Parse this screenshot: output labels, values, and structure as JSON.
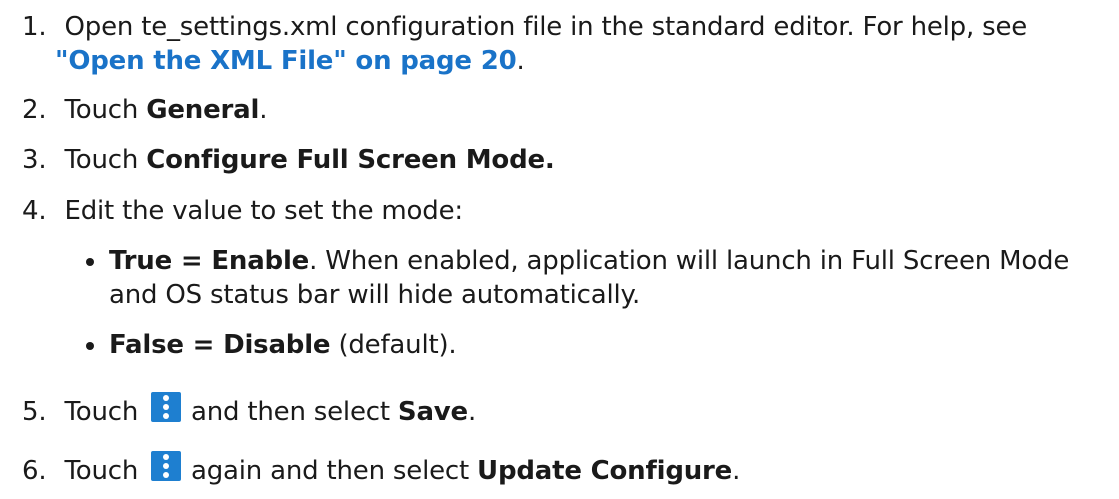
{
  "steps": [
    {
      "num": "1.",
      "pre": "Open te_settings.xml configuration file in the standard editor. For help, see",
      "link": "\"Open the XML File\" on page 20",
      "post": "."
    },
    {
      "num": "2.",
      "pre": "Touch ",
      "bold": "General",
      "post": "."
    },
    {
      "num": "3.",
      "pre": "Touch ",
      "bold": "Configure Full Screen Mode."
    },
    {
      "num": "4.",
      "text": "Edit the value to set the mode:"
    },
    {
      "num": "5.",
      "pre": "Touch",
      "mid": "and then select ",
      "bold": "Save",
      "post": "."
    },
    {
      "num": "6.",
      "pre": "Touch",
      "mid": "again and then select ",
      "bold": "Update Configure",
      "post": "."
    }
  ],
  "bullets": [
    {
      "bold": "True = Enable",
      "text": ". When enabled, application will launch in Full Screen Mode",
      "cont": "and OS status bar will hide automatically."
    },
    {
      "bold": "False = Disable",
      "text": " (default)."
    }
  ],
  "icons": {
    "menu_button": "more-vertical-icon",
    "menu_color": "#1e7fd0",
    "link_color": "#1a73c8"
  }
}
